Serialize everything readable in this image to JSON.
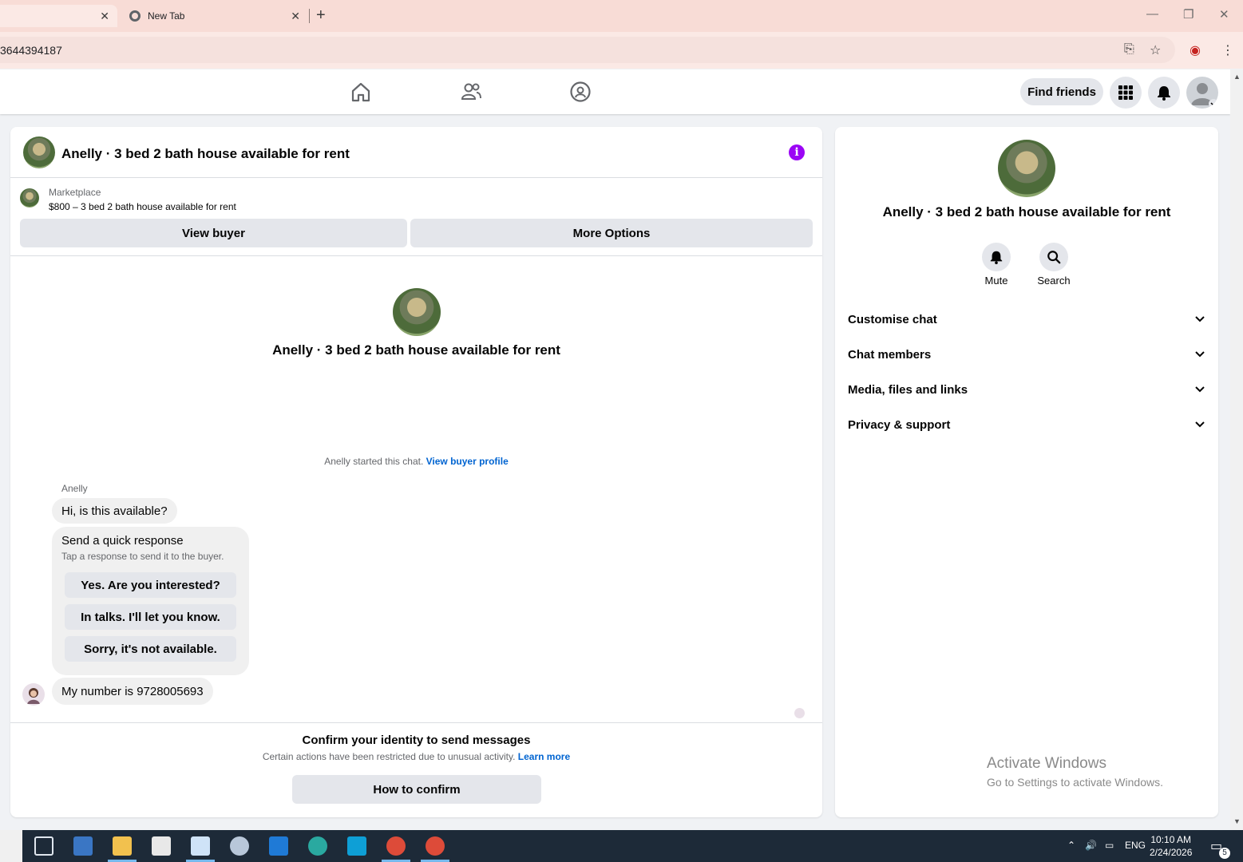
{
  "browser": {
    "tabs": [
      {
        "title": ""
      },
      {
        "title": "New Tab"
      }
    ],
    "url": "3644394187"
  },
  "header": {
    "find_friends": "Find friends"
  },
  "chat": {
    "title": "Anelly · 3 bed 2 bath house available for rent",
    "marketplace_label": "Marketplace",
    "listing": "$800 – 3 bed 2 bath house available for rent",
    "view_buyer": "View buyer",
    "more_options": "More Options",
    "center_title": "Anelly · 3 bed 2 bath house available for rent",
    "started_text": "Anelly started this chat.",
    "view_buyer_profile": "View buyer profile",
    "sender_name": "Anelly",
    "messages": [
      {
        "text": "Hi, is this available?"
      },
      {
        "text": "My number is 9728005693"
      }
    ],
    "quick_response": {
      "title": "Send a quick response",
      "subtitle": "Tap a response to send it to the buyer.",
      "options": [
        "Yes. Are you interested?",
        "In talks. I'll let you know.",
        "Sorry, it's not available."
      ]
    },
    "confirm": {
      "title": "Confirm your identity to send messages",
      "subtitle": "Certain actions have been restricted due to unusual activity.",
      "learn_more": "Learn more",
      "button": "How to confirm"
    }
  },
  "side": {
    "title": "Anelly · 3 bed 2 bath house available for rent",
    "actions": [
      {
        "label": "Mute"
      },
      {
        "label": "Search"
      }
    ],
    "sections": [
      "Customise chat",
      "Chat members",
      "Media, files and links",
      "Privacy & support"
    ]
  },
  "watermark": {
    "line1": "Activate Windows",
    "line2": "Go to Settings to activate Windows."
  },
  "taskbar": {
    "lang": "ENG",
    "time": "10:10 AM",
    "date": "2/24/2026",
    "notifications": "5"
  },
  "colors": {
    "accent_purple": "#9b05f5",
    "link_blue": "#0064d1",
    "button_gray": "#e4e6eb"
  }
}
